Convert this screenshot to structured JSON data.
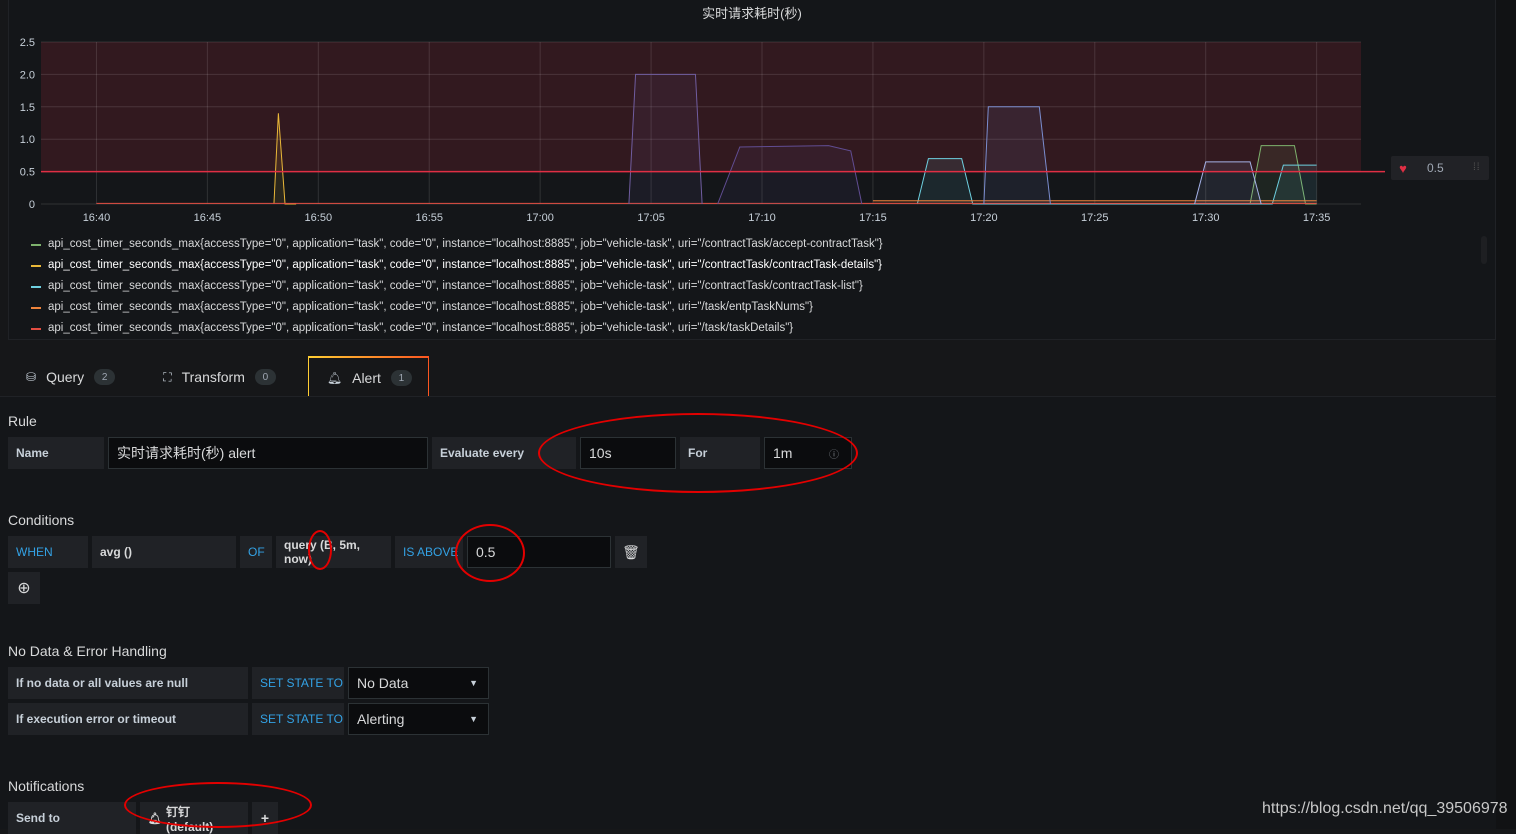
{
  "chart_data": {
    "type": "line",
    "title": "实时请求耗时(秒)",
    "ylim": [
      0,
      2.5
    ],
    "y_ticks": [
      "2.5",
      "2.0",
      "1.5",
      "1.0",
      "0.5",
      "0"
    ],
    "x_ticks": [
      "16:40",
      "16:45",
      "16:50",
      "16:55",
      "17:00",
      "17:05",
      "17:10",
      "17:15",
      "17:20",
      "17:25",
      "17:30",
      "17:35"
    ],
    "threshold": 0.5,
    "threshold_color": "#e02f44",
    "series": [
      {
        "name": "api_cost_timer_seconds_max{accessType=\"0\", application=\"task\", code=\"0\", instance=\"localhost:8885\", job=\"vehicle-task\", uri=\"/contractTask/accept-contractTask\"}",
        "color": "#7eb26d",
        "x": [
          "17:32",
          "17:32.5",
          "17:33.5",
          "17:34",
          "17:34.5",
          "17:35"
        ],
        "values": [
          0,
          0.9,
          0.9,
          0.9,
          0,
          0
        ]
      },
      {
        "name": "api_cost_timer_seconds_max{accessType=\"0\", application=\"task\", code=\"0\", instance=\"localhost:8885\", job=\"vehicle-task\", uri=\"/contractTask/contractTask-details\"}",
        "color": "#eab839",
        "x": [
          "16:48",
          "16:48.2",
          "16:48.5",
          "16:49"
        ],
        "values": [
          0,
          1.4,
          0,
          0
        ]
      },
      {
        "name": "api_cost_timer_seconds_max{accessType=\"0\", application=\"task\", code=\"0\", instance=\"localhost:8885\", job=\"vehicle-task\", uri=\"/contractTask/contractTask-list\"}",
        "color": "#6ed0e0",
        "x": [
          "17:17",
          "17:17.5",
          "17:19",
          "17:19.5",
          "17:33",
          "17:33.5",
          "17:35"
        ],
        "values": [
          0,
          0.7,
          0.7,
          0,
          0,
          0.6,
          0.6
        ]
      },
      {
        "name": "api_cost_timer_seconds_max{accessType=\"0\", application=\"task\", code=\"0\", instance=\"localhost:8885\", job=\"vehicle-task\", uri=\"/task/entpTaskNums\"}",
        "color": "#ef843c",
        "x": [
          "17:15",
          "17:35"
        ],
        "values": [
          0.05,
          0.05
        ]
      },
      {
        "name": "api_cost_timer_seconds_max{accessType=\"0\", application=\"task\", code=\"0\", instance=\"localhost:8885\", job=\"vehicle-task\", uri=\"/task/taskDetails\"}",
        "color": "#e24d42",
        "x": [
          "16:40",
          "17:35"
        ],
        "values": [
          0.01,
          0.01
        ]
      },
      {
        "name": "",
        "color": "#705da0",
        "x": [
          "17:04",
          "17:04.3",
          "17:07",
          "17:07.3"
        ],
        "values": [
          0,
          2.0,
          2.0,
          0
        ]
      },
      {
        "name": "",
        "color": "#614d93",
        "x": [
          "17:08",
          "17:09",
          "17:13",
          "17:14",
          "17:14.5"
        ],
        "values": [
          0,
          0.88,
          0.9,
          0.82,
          0
        ]
      },
      {
        "name": "",
        "color": "#7b8dcf",
        "x": [
          "17:20",
          "17:20.2",
          "17:22.5",
          "17:23"
        ],
        "values": [
          0,
          1.5,
          1.5,
          0
        ]
      },
      {
        "name": "",
        "color": "#a5b2e8",
        "x": [
          "17:29.5",
          "17:30",
          "17:32",
          "17:32.5"
        ],
        "values": [
          0,
          0.65,
          0.65,
          0
        ]
      }
    ]
  },
  "threshold_handle": {
    "value": "0.5"
  },
  "tabs": [
    {
      "label": "Query",
      "count": "2"
    },
    {
      "label": "Transform",
      "count": "0"
    },
    {
      "label": "Alert",
      "count": "1"
    }
  ],
  "rule": {
    "section": "Rule",
    "name_label": "Name",
    "name_value": "实时请求耗时(秒) alert",
    "evaluate_label": "Evaluate every",
    "evaluate_value": "10s",
    "for_label": "For",
    "for_value": "1m"
  },
  "conditions": {
    "section": "Conditions",
    "when": "WHEN",
    "func": "avg ()",
    "of": "OF",
    "query": "query (B, 5m, now)",
    "is_above": "IS ABOVE",
    "threshold": "0.5"
  },
  "nodata": {
    "section": "No Data & Error Handling",
    "row1_label": "If no data or all values are null",
    "row1_set": "SET STATE TO",
    "row1_value": "No Data",
    "row2_label": "If execution error or timeout",
    "row2_set": "SET STATE TO",
    "row2_value": "Alerting"
  },
  "notifications": {
    "section": "Notifications",
    "send_to_label": "Send to",
    "channel": "钉钉 (default)"
  },
  "watermark": "https://blog.csdn.net/qq_39506978"
}
